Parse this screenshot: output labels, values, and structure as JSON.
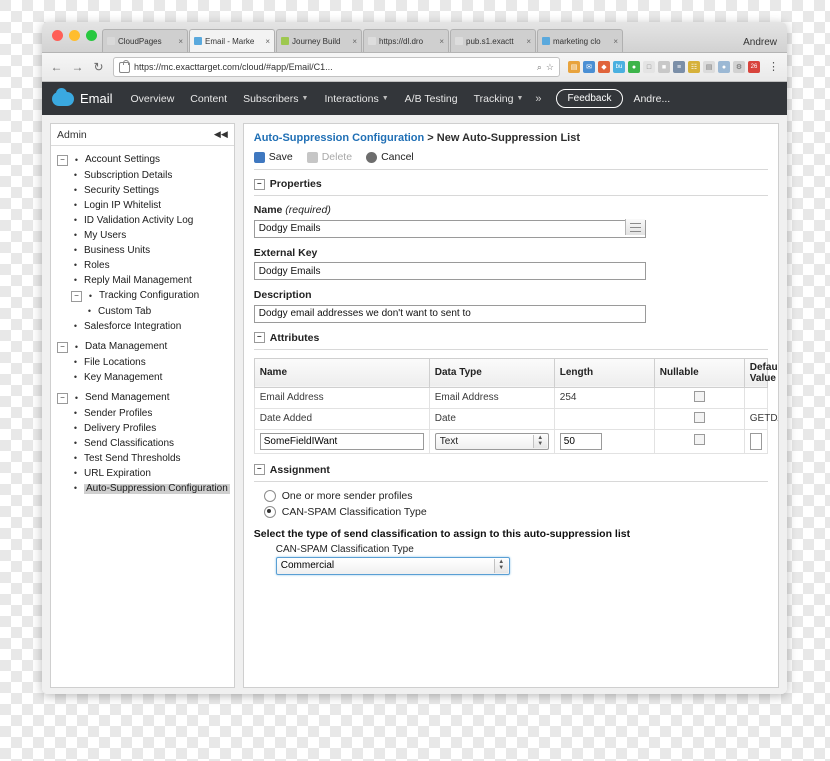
{
  "browser": {
    "user": "Andrew",
    "tabs": [
      {
        "label": "CloudPages",
        "favicon": "#d9d9d9",
        "active": false
      },
      {
        "label": "Email - Marke",
        "favicon": "#5aa9dd",
        "active": true
      },
      {
        "label": "Journey Build",
        "favicon": "#9ec84f",
        "active": false
      },
      {
        "label": "https://dl.dro",
        "favicon": "#dddddd",
        "active": false
      },
      {
        "label": "pub.s1.exactt",
        "favicon": "#dddddd",
        "active": false
      },
      {
        "label": "marketing clo",
        "favicon": "#5aa9dd",
        "active": false
      }
    ],
    "nav": {
      "back": "←",
      "forward": "→",
      "reload": "↻"
    },
    "url": "https://mc.exacttarget.com/cloud/#app/Email/C1...",
    "url_icons": {
      "search": "⌕",
      "bookmark": "☆"
    },
    "extensions": [
      {
        "name": "notes-extension",
        "glyph": "▤",
        "color": "#e8a33d"
      },
      {
        "name": "mail-extension",
        "glyph": "✉",
        "color": "#4a8fd4"
      },
      {
        "name": "shield-extension",
        "glyph": "◆",
        "color": "#e0643c"
      },
      {
        "name": "bu-extension",
        "glyph": "bu",
        "color": "#4ab0e0"
      },
      {
        "name": "green-circle-extension",
        "glyph": "●",
        "color": "#3cb44a"
      },
      {
        "name": "window-extension",
        "glyph": "□",
        "color": "#c8c8c8"
      },
      {
        "name": "square-extension",
        "glyph": "■",
        "color": "#b8b8b8"
      },
      {
        "name": "list-extension",
        "glyph": "≡",
        "color": "#7b8fa8"
      },
      {
        "name": "grid-extension",
        "glyph": "☷",
        "color": "#d6b13a"
      },
      {
        "name": "doc-extension",
        "glyph": "▤",
        "color": "#cccccc"
      },
      {
        "name": "dot-extension",
        "glyph": "●",
        "color": "#9bb8d4"
      },
      {
        "name": "gear-extension",
        "glyph": "⚙",
        "color": "#c9c9c9"
      },
      {
        "name": "calendar-extension",
        "glyph": "26",
        "color": "#d8443c"
      }
    ],
    "menu": "⋮"
  },
  "appheader": {
    "logo_label": "Email",
    "nav": [
      {
        "label": "Overview",
        "caret": false
      },
      {
        "label": "Content",
        "caret": false
      },
      {
        "label": "Subscribers",
        "caret": true
      },
      {
        "label": "Interactions",
        "caret": true
      },
      {
        "label": "A/B Testing",
        "caret": false
      },
      {
        "label": "Tracking",
        "caret": true
      }
    ],
    "more": "»",
    "feedback_label": "Feedback",
    "user": "Andre..."
  },
  "sidebar": {
    "title": "Admin",
    "collapse_icon": "◀◀",
    "items": [
      {
        "label": "Account Settings",
        "level": 1,
        "marker": "expander-minus",
        "selected": false
      },
      {
        "label": "Subscription Details",
        "level": 2,
        "marker": "bullet",
        "selected": false
      },
      {
        "label": "Security Settings",
        "level": 2,
        "marker": "bullet",
        "selected": false
      },
      {
        "label": "Login IP Whitelist",
        "level": 2,
        "marker": "bullet",
        "selected": false
      },
      {
        "label": "ID Validation Activity Log",
        "level": 2,
        "marker": "bullet",
        "selected": false
      },
      {
        "label": "My Users",
        "level": 2,
        "marker": "bullet",
        "selected": false
      },
      {
        "label": "Business Units",
        "level": 2,
        "marker": "bullet",
        "selected": false
      },
      {
        "label": "Roles",
        "level": 2,
        "marker": "bullet",
        "selected": false
      },
      {
        "label": "Reply Mail Management",
        "level": 2,
        "marker": "bullet",
        "selected": false
      },
      {
        "label": "Tracking Configuration",
        "level": 2,
        "marker": "expander-minus",
        "selected": false
      },
      {
        "label": "Custom Tab",
        "level": 3,
        "marker": "bullet",
        "selected": false
      },
      {
        "label": "Salesforce Integration",
        "level": 2,
        "marker": "bullet",
        "selected": false
      },
      {
        "label": "Data Management",
        "level": 1,
        "marker": "expander-minus",
        "selected": false
      },
      {
        "label": "File Locations",
        "level": 2,
        "marker": "bullet",
        "selected": false
      },
      {
        "label": "Key Management",
        "level": 2,
        "marker": "bullet",
        "selected": false
      },
      {
        "label": "Send Management",
        "level": 1,
        "marker": "expander-minus",
        "selected": false
      },
      {
        "label": "Sender Profiles",
        "level": 2,
        "marker": "bullet",
        "selected": false
      },
      {
        "label": "Delivery Profiles",
        "level": 2,
        "marker": "bullet",
        "selected": false
      },
      {
        "label": "Send Classifications",
        "level": 2,
        "marker": "bullet",
        "selected": false
      },
      {
        "label": "Test Send Thresholds",
        "level": 2,
        "marker": "bullet",
        "selected": false
      },
      {
        "label": "URL Expiration",
        "level": 2,
        "marker": "bullet",
        "selected": false
      },
      {
        "label": "Auto-Suppression Configuration",
        "level": 2,
        "marker": "bullet",
        "selected": true
      }
    ]
  },
  "main": {
    "breadcrumb_link": "Auto-Suppression Configuration",
    "breadcrumb_sep": " > ",
    "breadcrumb_current": "New Auto-Suppression List",
    "actions": [
      {
        "label": "Save",
        "icon": "save-icon",
        "color": "#3f78c0",
        "disabled": false
      },
      {
        "label": "Delete",
        "icon": "trash-icon",
        "color": "#b0b0b0",
        "disabled": true
      },
      {
        "label": "Cancel",
        "icon": "cancel-icon",
        "color": "#4a4a4a",
        "disabled": false
      }
    ],
    "properties": {
      "section_label": "Properties",
      "name_label": "Name",
      "name_label_hint": "(required)",
      "name_value": "Dodgy Emails",
      "name_picker_icon": "keyboard-icon",
      "external_key_label": "External Key",
      "external_key_value": "Dodgy Emails",
      "description_label": "Description",
      "description_value": "Dodgy email addresses we don't want to sent to"
    },
    "attributes": {
      "section_label": "Attributes",
      "columns": [
        "Name",
        "Data Type",
        "Length",
        "Nullable",
        "Default Value"
      ],
      "rows": [
        {
          "name": "Email Address",
          "data_type": "Email Address",
          "length": "254",
          "nullable": false,
          "default": "",
          "editable": false
        },
        {
          "name": "Date Added",
          "data_type": "Date",
          "length": "",
          "nullable": false,
          "default": "GETDATE()",
          "editable": false
        },
        {
          "name": "SomeFieldIWant",
          "data_type": "Text",
          "length": "50",
          "nullable": false,
          "default": "",
          "editable": true
        }
      ]
    },
    "assignment": {
      "section_label": "Assignment",
      "options": [
        {
          "label": "One or more sender profiles",
          "selected": false
        },
        {
          "label": "CAN-SPAM Classification Type",
          "selected": true
        }
      ],
      "instruction": "Select the type of send classification to assign to this auto-suppression list",
      "select_label": "CAN-SPAM Classification Type",
      "select_value": "Commercial"
    }
  }
}
